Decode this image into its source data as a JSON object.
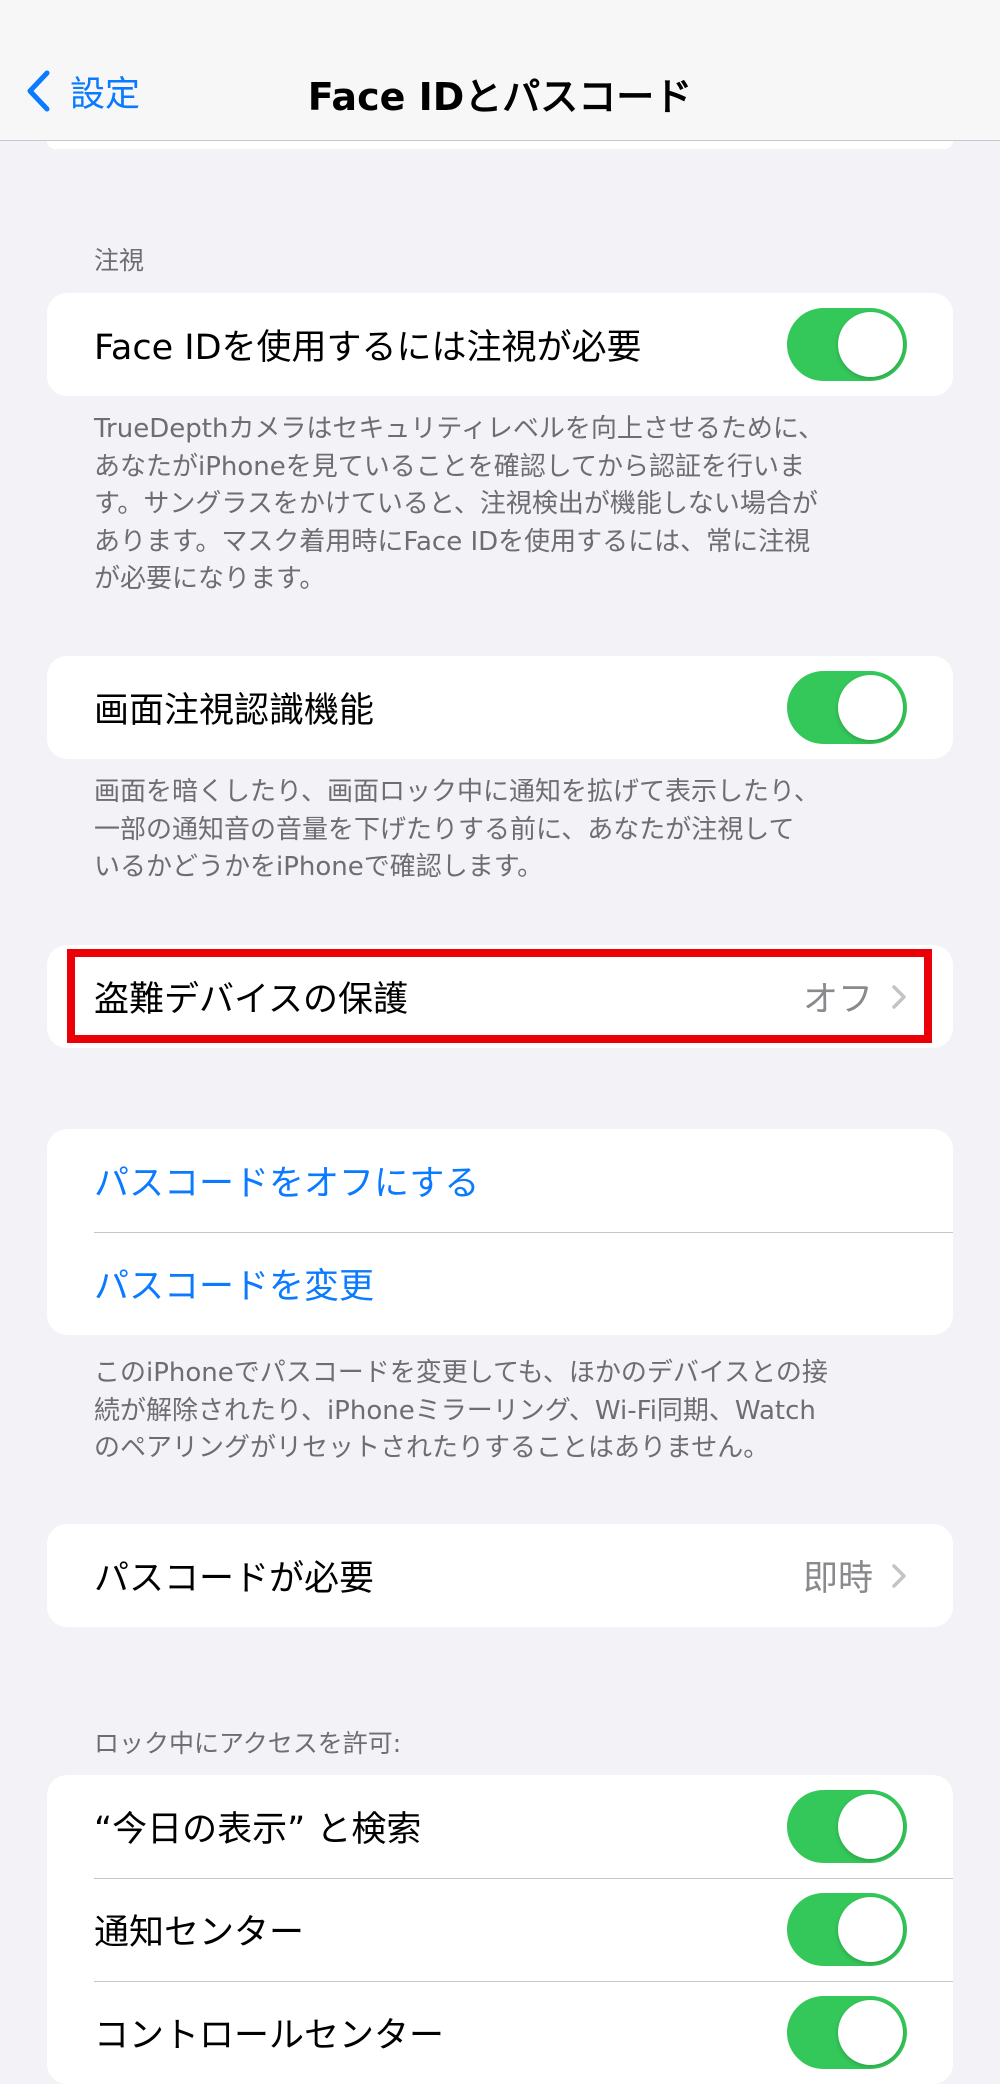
{
  "nav": {
    "back_label": "設定",
    "title": "Face IDとパスコード"
  },
  "attention": {
    "header": "注視",
    "require_attention": {
      "label": "Face IDを使用するには注視が必要",
      "toggle_on": true
    },
    "footer": "TrueDepthカメラはセキュリティレベルを向上させるために、\nあなたがiPhoneを見ていることを確認してから認証を行いま\nす。サングラスをかけていると、注視検出が機能しない場合が\nあります。マスク着用時にFace IDを使用するには、常に注視\nが必要になります。"
  },
  "attention_aware": {
    "label": "画面注視認識機能",
    "toggle_on": true,
    "footer": "画面を暗くしたり、画面ロック中に通知を拡げて表示したり、\n一部の通知音の音量を下げたりする前に、あなたが注視して\nいるかどうかをiPhoneで確認します。"
  },
  "stolen_device": {
    "label": "盗難デバイスの保護",
    "value": "オフ"
  },
  "passcode": {
    "turn_off_label": "パスコードをオフにする",
    "change_label": "パスコードを変更",
    "footer": "このiPhoneでパスコードを変更しても、ほかのデバイスとの接\n続が解除されたり、iPhoneミラーリング、Wi-Fi同期、Watch\nのペアリングがリセットされたりすることはありません。"
  },
  "require_passcode": {
    "label": "パスコードが必要",
    "value": "即時"
  },
  "lock_access": {
    "header": "ロック中にアクセスを許可:",
    "items": [
      {
        "label": "“今日の表示” と検索",
        "toggle_on": true
      },
      {
        "label": "通知センター",
        "toggle_on": true
      },
      {
        "label": "コントロールセンター",
        "toggle_on": true
      }
    ]
  },
  "colors": {
    "accent_blue": "#0a7aff",
    "toggle_green": "#34c759",
    "highlight_red": "#ec0008",
    "background": "#f2f2f7"
  }
}
